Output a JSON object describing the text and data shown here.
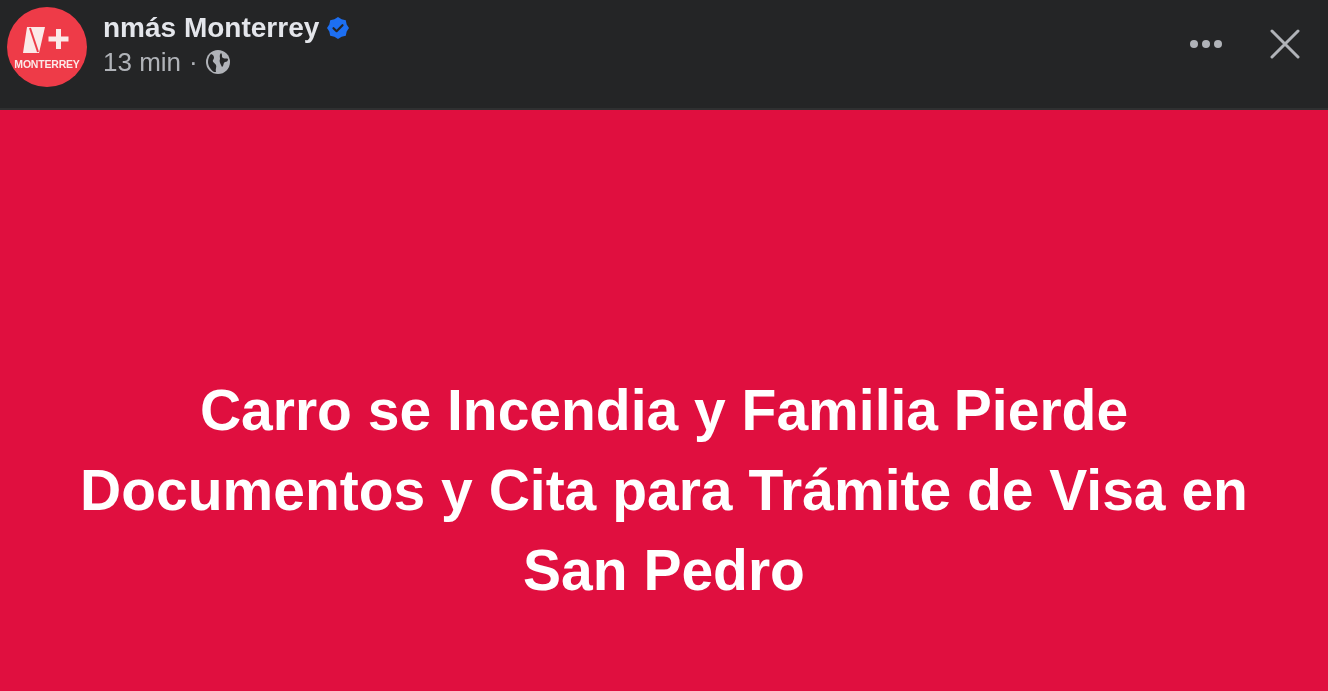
{
  "post": {
    "avatar": {
      "label": "MONTERREY"
    },
    "page_name": "nmás Monterrey",
    "verified": true,
    "time": "13 min",
    "separator": "·"
  },
  "headline": "Carro se Incendia y Familia Pierde Documentos y Cita para Trámite de Visa en San Pedro"
}
